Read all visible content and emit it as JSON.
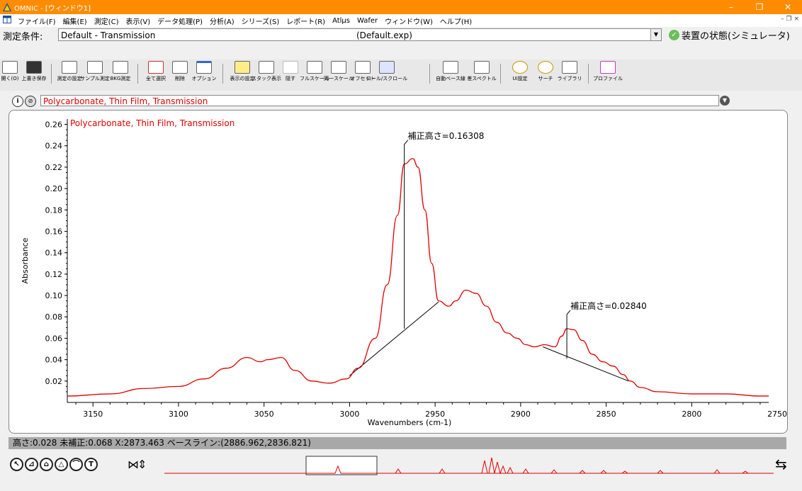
{
  "window": {
    "title": "OMNIC - [ウィンドウ1]",
    "min": "–",
    "restore": "❐",
    "close": "✕"
  },
  "menu": [
    "ファイル(F)",
    "編集(E)",
    "測定(C)",
    "表示(V)",
    "データ処理(P)",
    "分析(A)",
    "シリーズ(S)",
    "レポート(R)",
    "Atlμs",
    "Wafer",
    "ウィンドウ(W)",
    "ヘルプ(H)"
  ],
  "menu_mdi": "– ❐ ×",
  "conditions": {
    "label": "測定条件:",
    "value": "Default - Transmission",
    "exp": "(Default.exp)",
    "status": "装置の状態(シミュレータ)"
  },
  "toolbar": [
    {
      "label": "開く(O)"
    },
    {
      "label": "上書き保存"
    },
    {
      "label": "測定の設定"
    },
    {
      "label": "サンプル測定"
    },
    {
      "label": "BKG測定"
    },
    {
      "label": "全て選択"
    },
    {
      "label": "削除"
    },
    {
      "label": "オプション"
    },
    {
      "label": "表示の設定"
    },
    {
      "label": "スタック表示"
    },
    {
      "label": "隠す"
    },
    {
      "label": "フルスケール"
    },
    {
      "label": "同一スケール"
    },
    {
      "label": "オフセット"
    },
    {
      "label": "ロール/スクロール"
    },
    {
      "label": "自動ベース線"
    },
    {
      "label": "差スペクトル"
    },
    {
      "label": "UI設定"
    },
    {
      "label": "サーチ"
    },
    {
      "label": "ライブラリ"
    },
    {
      "label": "プロファイル"
    }
  ],
  "spectrum_selector": {
    "value": "Polycarbonate, Thin Film, Transmission"
  },
  "status": {
    "text": "高さ:0.028 未補正:0.068 X:2873.463 ベースライン:(2886.962,2836.821)"
  },
  "colors": {
    "titlebar": "#ff8c00",
    "spectrum": "#e00000"
  },
  "chart_data": {
    "type": "line",
    "title": "Polycarbonate, Thin Film, Transmission",
    "xlabel": "Wavenumbers (cm-1)",
    "ylabel": "Absorbance",
    "xlim": [
      3165,
      2755
    ],
    "ylim": [
      0.0,
      0.265
    ],
    "x_ticks": [
      3150,
      3100,
      3050,
      3000,
      2950,
      2900,
      2850,
      2800,
      2750
    ],
    "y_ticks": [
      0.02,
      0.04,
      0.06,
      0.08,
      0.1,
      0.12,
      0.14,
      0.16,
      0.18,
      0.2,
      0.22,
      0.24,
      0.26
    ],
    "series": [
      {
        "x": [
          3165,
          3140,
          3120,
          3100,
          3085,
          3072,
          3060,
          3052,
          3048,
          3040,
          3032,
          3022,
          3012,
          3002,
          2995,
          2985,
          2978,
          2972,
          2968,
          2963,
          2960,
          2956,
          2952,
          2948,
          2942,
          2938,
          2932,
          2926,
          2920,
          2914,
          2908,
          2902,
          2897,
          2892,
          2886,
          2880,
          2876,
          2873,
          2869,
          2864,
          2858,
          2852,
          2846,
          2840,
          2836,
          2830,
          2820,
          2800,
          2780,
          2760,
          2755
        ],
        "y": [
          0.006,
          0.008,
          0.013,
          0.015,
          0.022,
          0.032,
          0.042,
          0.038,
          0.04,
          0.042,
          0.03,
          0.02,
          0.018,
          0.022,
          0.032,
          0.06,
          0.11,
          0.175,
          0.223,
          0.228,
          0.22,
          0.18,
          0.13,
          0.095,
          0.09,
          0.095,
          0.105,
          0.102,
          0.09,
          0.075,
          0.065,
          0.06,
          0.054,
          0.052,
          0.054,
          0.052,
          0.062,
          0.069,
          0.068,
          0.058,
          0.045,
          0.038,
          0.034,
          0.026,
          0.02,
          0.014,
          0.01,
          0.008,
          0.008,
          0.006,
          0.006
        ]
      }
    ],
    "annotations": [
      {
        "label": "補正高さ=0.16308",
        "x": 2968,
        "top": 0.228,
        "base": 0.069
      },
      {
        "label": "補正高さ=0.02840",
        "x": 2873,
        "top": 0.069,
        "base": 0.041
      }
    ],
    "baselines": [
      {
        "x1": 3000,
        "y1": 0.025,
        "x2": 2948,
        "y2": 0.094
      },
      {
        "x1": 2887,
        "y1": 0.052,
        "x2": 2837,
        "y2": 0.02
      }
    ]
  }
}
